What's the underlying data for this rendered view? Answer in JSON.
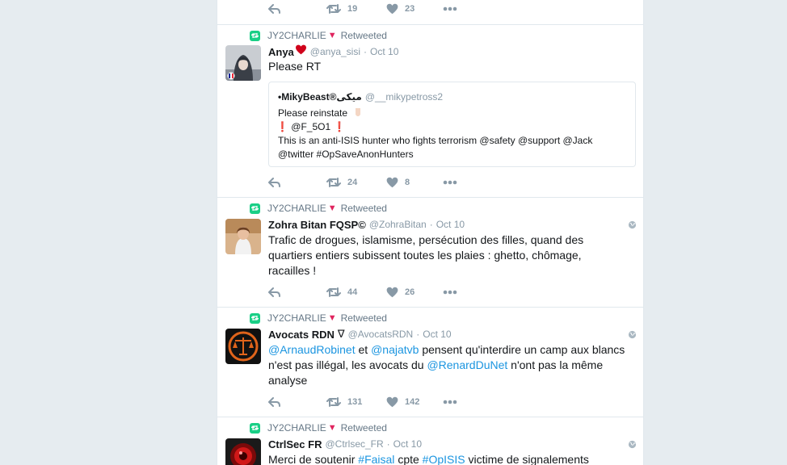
{
  "top_actions": {
    "retweets": "19",
    "likes": "23"
  },
  "tweets": [
    {
      "retweeter": "JY2CHARLIE",
      "retweeted_label": "Retweeted",
      "name": "Anya",
      "handle": "@anya_sisi",
      "separator": "·",
      "time": "Oct 10",
      "text": "Please RT",
      "quote": {
        "name": "•MikyBeast®میکی",
        "handle": "@__mikypetross2",
        "line1": "Please reinstate",
        "mention": "@F_5O1",
        "line3": "This is an anti-ISIS hunter who fights terrorism @safety @support @Jack",
        "line4": "@twitter #OpSaveAnonHunters"
      },
      "retweets": "24",
      "likes": "8"
    },
    {
      "retweeter": "JY2CHARLIE",
      "retweeted_label": "Retweeted",
      "name": "Zohra Bitan FQSP©",
      "handle": "@ZohraBitan",
      "separator": "·",
      "time": "Oct 10",
      "lines": [
        "Trafic de drogues, islamisme, persécution des filles, quand des",
        "quartiers entiers subissent toutes les plaies : ghetto, chômage,",
        "racailles !"
      ],
      "retweets": "44",
      "likes": "26"
    },
    {
      "retweeter": "JY2CHARLIE",
      "retweeted_label": "Retweeted",
      "name": "Avocats RDN",
      "badge": "∇",
      "handle": "@AvocatsRDN",
      "separator": "·",
      "time": "Oct 10",
      "mention1": "@ArnaudRobinet",
      "word_et": "et",
      "mention2": "@najatvb",
      "line1_rest": "pensent qu'interdire un camp aux blancs",
      "line2_start": "n'est pas illégal, les avocats du",
      "mention3": "@RenardDuNet",
      "line2_end": "n'ont pas la même",
      "line3": "analyse",
      "retweets": "131",
      "likes": "142"
    },
    {
      "retweeter": "JY2CHARLIE",
      "retweeted_label": "Retweeted",
      "name": "CtrlSec FR",
      "handle": "@Ctrlsec_FR",
      "separator": "·",
      "time": "Oct 10",
      "line_start": "Merci de soutenir",
      "hashtag1": "#Faisal",
      "word_cpte": "cpte",
      "hashtag2": "#OpISIS",
      "line_end": "victime de signalements"
    }
  ],
  "colors": {
    "link": "#1b95e0",
    "retweet_badge": "#19cf86",
    "heart": "#e0245e",
    "meta": "#8899a6"
  }
}
